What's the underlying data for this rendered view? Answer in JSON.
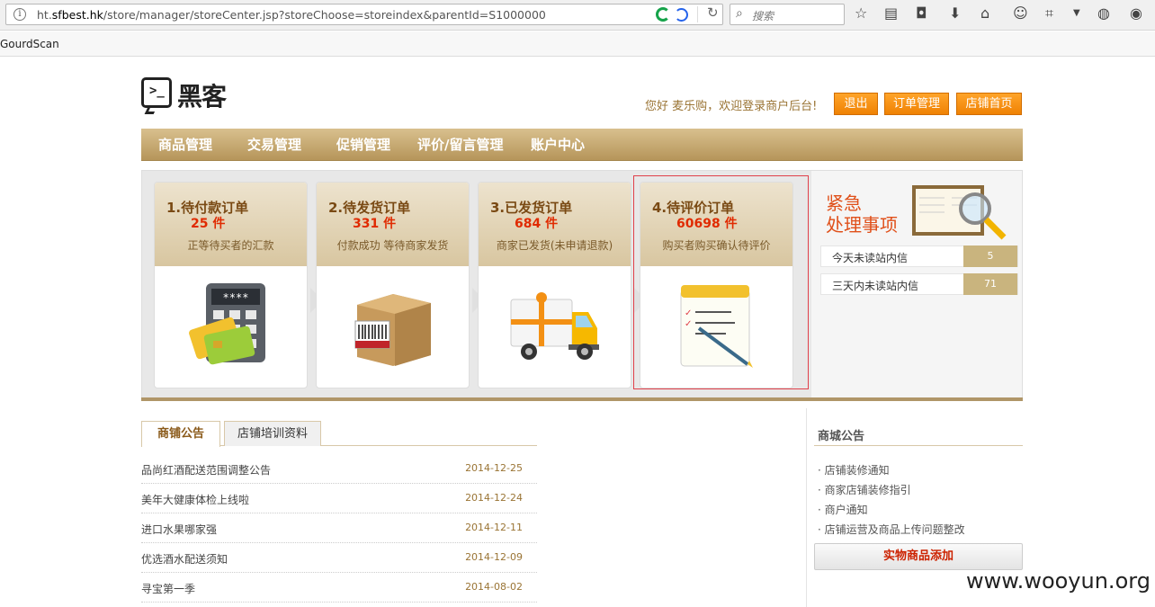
{
  "browser": {
    "url_prefix": "ht.",
    "url_host": "sfbest.hk",
    "url_path": "/store/manager/storeCenter.jsp?storeChoose=storeindex&parentId=S1000000",
    "search_placeholder": "搜索",
    "bookmark": "GourdScan"
  },
  "header": {
    "logo_text": "黑客",
    "logo_prompt": ">_",
    "welcome": "您好   麦乐购，欢迎登录商户后台!",
    "buttons": [
      "退出",
      "订单管理",
      "店铺首页"
    ]
  },
  "nav": {
    "items": [
      "商品管理",
      "交易管理",
      "促销管理",
      "评价/留言管理",
      "账户中心"
    ]
  },
  "tasks": [
    {
      "title": "1.待付款订单",
      "count": "25 件",
      "desc": "正等待买者的汇款",
      "icon": "calculator-cards-icon"
    },
    {
      "title": "2.待发货订单",
      "count": "331 件",
      "desc": "付款成功   等待商家发货",
      "icon": "package-box-icon"
    },
    {
      "title": "3.已发货订单",
      "count": "684 件",
      "desc": "商家已发货(未申请退款)",
      "icon": "delivery-truck-icon"
    },
    {
      "title": "4.待评价订单",
      "count": "60698 件",
      "desc": "购买者购买确认待评价",
      "icon": "notepad-pen-icon"
    }
  ],
  "urgent": {
    "title_line1": "紧急",
    "title_line2": "处理事项",
    "rows": [
      {
        "label": "今天未读站内信",
        "value": "5"
      },
      {
        "label": "三天内未读站内信",
        "value": "71"
      }
    ]
  },
  "tabs": [
    "商铺公告",
    "店铺培训资料"
  ],
  "announcements": [
    {
      "title": "品尚红酒配送范围调整公告",
      "date": "2014-12-25"
    },
    {
      "title": "美年大健康体检上线啦",
      "date": "2014-12-24"
    },
    {
      "title": "进口水果哪家强",
      "date": "2014-12-11"
    },
    {
      "title": "优选酒水配送须知",
      "date": "2014-12-09"
    },
    {
      "title": "寻宝第一季",
      "date": "2014-08-02"
    }
  ],
  "mall": {
    "title": "商城公告",
    "items": [
      "· 店铺装修通知",
      "· 商家店铺装修指引",
      "· 商户通知",
      "· 店铺运营及商品上传问题整改"
    ],
    "add_button": "实物商品添加"
  },
  "watermark": "www.wooyun.org",
  "colors": {
    "accent": "#f39014",
    "nav": "#c8ab75",
    "highlight": "#e0404a",
    "count": "#e02a00"
  }
}
